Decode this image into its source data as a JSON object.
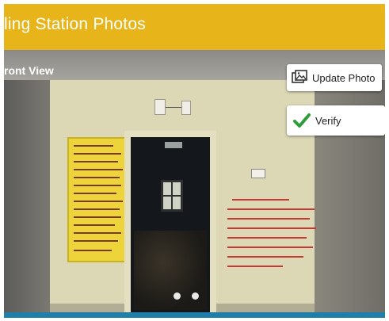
{
  "header": {
    "title": "ling Station Photos",
    "background_color": "#e7b51a"
  },
  "photo": {
    "view_label": "ront View",
    "carousel": {
      "page_count": 2,
      "current_page": 1
    }
  },
  "actions": {
    "update_photo": {
      "label": "Update Photo",
      "icon": "image-icon"
    },
    "verify": {
      "label": "Verify",
      "icon": "checkmark-icon",
      "icon_color": "#2e9e3a"
    }
  },
  "bottom_bar": {
    "color": "#1f7fa8"
  }
}
